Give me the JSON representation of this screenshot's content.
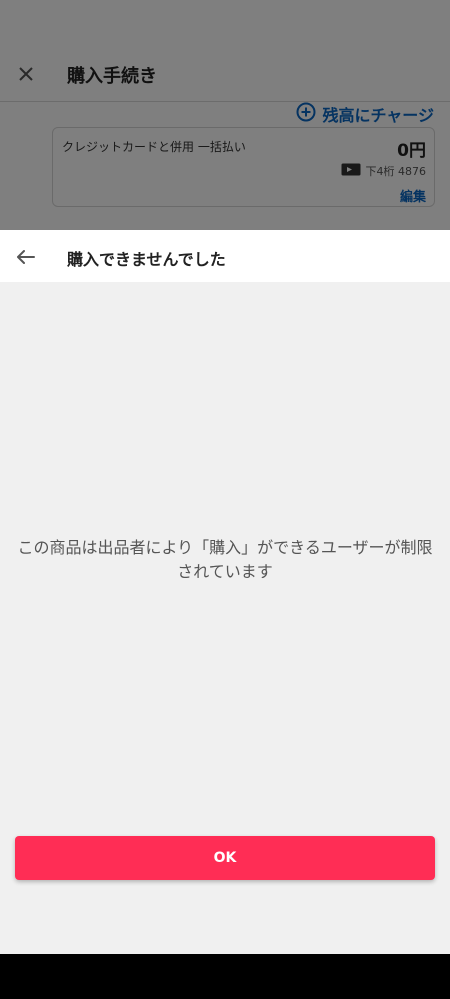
{
  "background_screen": {
    "title": "購入手続き",
    "close_icon": "close-icon",
    "charge_link": "残高にチャージ",
    "charge_icon": "plus-circle-icon",
    "payment_card": {
      "name": "クレジットカードと併用 一括払い",
      "amount": "0円",
      "card_icon": "card-icon",
      "last4": "下4桁 4876",
      "edit_label": "編集"
    }
  },
  "dialog": {
    "back_icon": "arrow-left-icon",
    "title": "購入できませんでした",
    "message": "この商品は出品者により「購入」ができるユーザーが制限されています",
    "ok_label": "OK"
  },
  "colors": {
    "accent": "#ff2d55",
    "link": "#0a66c2",
    "sheet_background": "#f0f0f0"
  }
}
